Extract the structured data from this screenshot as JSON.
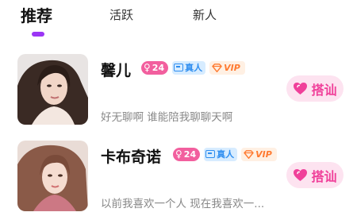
{
  "tabs": [
    {
      "label": "推荐",
      "active": true
    },
    {
      "label": "活跃",
      "active": false
    },
    {
      "label": "新人",
      "active": false
    }
  ],
  "users": [
    {
      "name": "馨儿",
      "gender_symbol": "♀",
      "age": "24",
      "real_label": "真人",
      "vip_label": "VIP",
      "bio": "好无聊啊 谁能陪我聊聊天啊",
      "chat_label": "搭讪"
    },
    {
      "name": "卡布奇诺",
      "gender_symbol": "♀",
      "age": "24",
      "real_label": "真人",
      "vip_label": "VIP",
      "bio": "以前我喜欢一个人 现在我喜欢一...",
      "chat_label": "搭讪"
    }
  ],
  "colors": {
    "accent": "#9b35f5",
    "chat_pink": "#f0409a",
    "age_badge": "#f25f9e",
    "real_badge": "#2f8ef0",
    "vip_badge": "#ff7a30"
  }
}
